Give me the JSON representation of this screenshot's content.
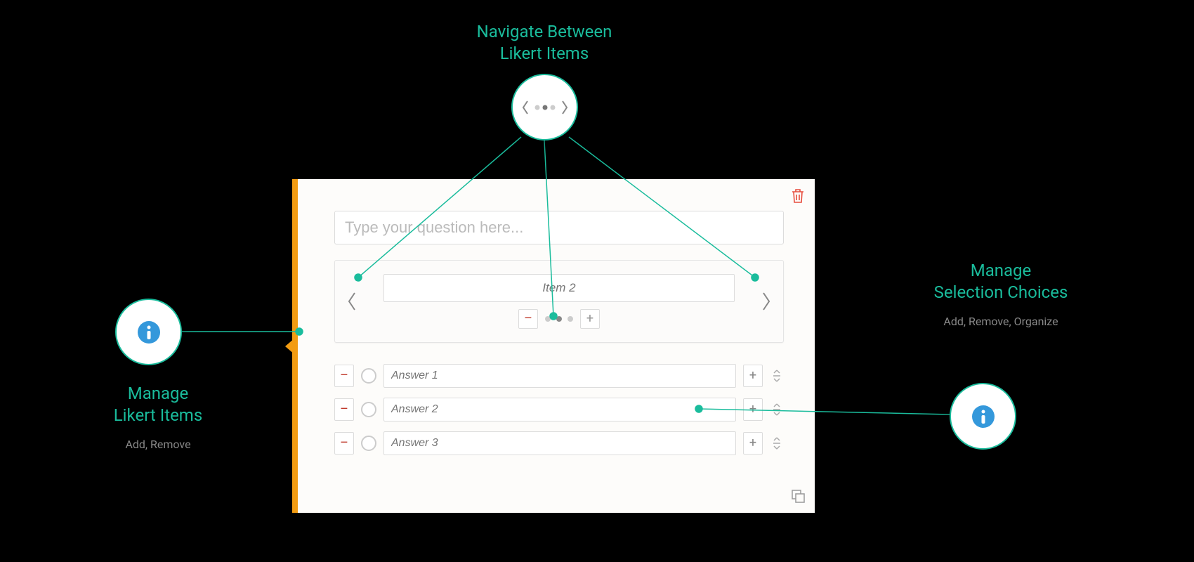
{
  "colors": {
    "accent_orange": "#f39c12",
    "accent_green": "#1abc9c",
    "info_blue": "#3498db",
    "trash_red": "#e74c3c"
  },
  "panel": {
    "question_placeholder": "Type your question here...",
    "item_label": "Item 2",
    "dot_count": 3,
    "active_dot_index": 1,
    "answers": [
      {
        "placeholder": "Answer 1"
      },
      {
        "placeholder": "Answer 2"
      },
      {
        "placeholder": "Answer 3"
      }
    ],
    "minus_glyph": "–",
    "plus_glyph": "+"
  },
  "callouts": {
    "top": {
      "title_line1": "Navigate Between",
      "title_line2": "Likert Items"
    },
    "left": {
      "title_line1": "Manage",
      "title_line2": "Likert Items",
      "subtitle": "Add, Remove"
    },
    "right": {
      "title_line1": "Manage",
      "title_line2": "Selection Choices",
      "subtitle": "Add, Remove, Organize"
    }
  },
  "icons": {
    "info": "i",
    "chevron_left": "‹",
    "chevron_right": "›"
  }
}
